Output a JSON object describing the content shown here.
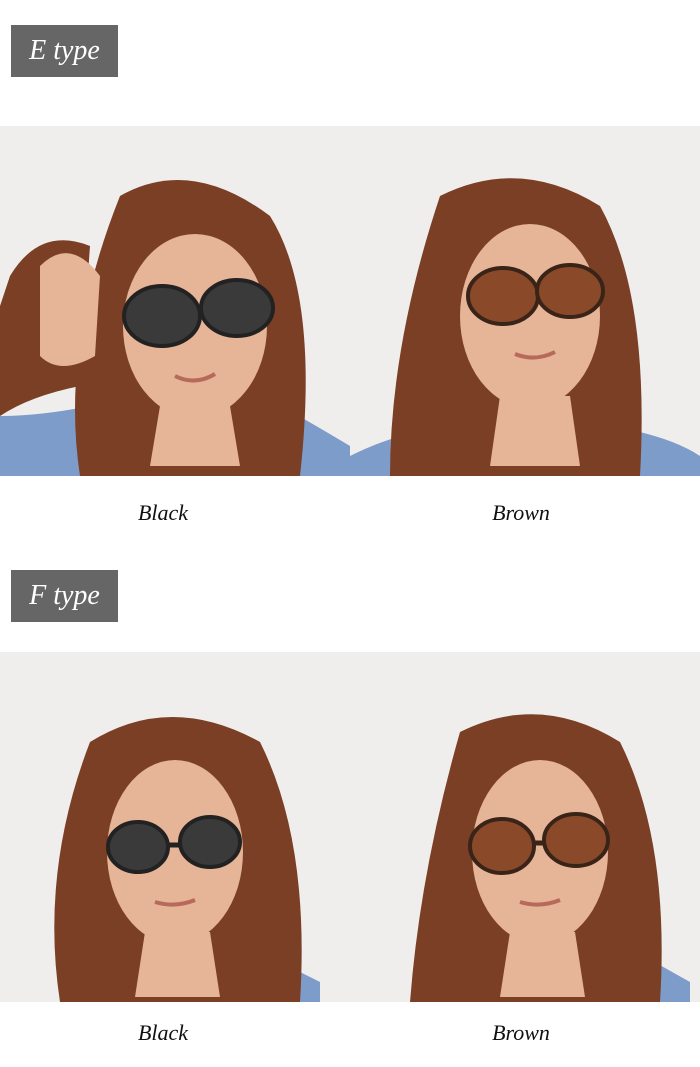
{
  "sections": [
    {
      "label": "E type",
      "variants": [
        {
          "caption": "Black",
          "lens_color": "#3a3a3a"
        },
        {
          "caption": "Brown",
          "lens_color": "#8a4a2a"
        }
      ]
    },
    {
      "label": "F type",
      "variants": [
        {
          "caption": "Black",
          "lens_color": "#3a3a3a"
        },
        {
          "caption": "Brown",
          "lens_color": "#8a4a2a"
        }
      ]
    }
  ],
  "colors": {
    "label_bg": "#666666",
    "hair": "#7a3f24",
    "skin": "#e6b496",
    "denim": "#7d9cc9",
    "background_wall": "#efeeec"
  }
}
